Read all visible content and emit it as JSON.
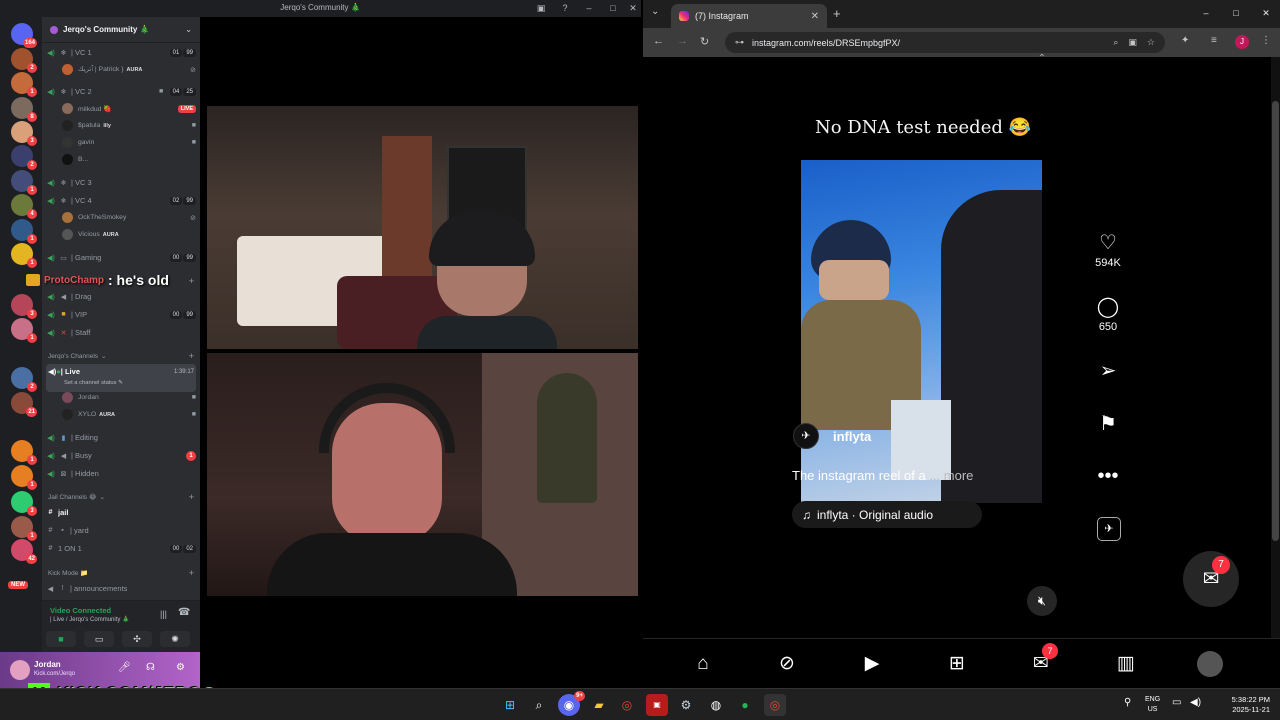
{
  "discord": {
    "window_title": "Jerqo's Community 🎄",
    "server_name": "Jerqo's Community 🎄",
    "rail_badges": [
      "164",
      "2",
      "1",
      "8",
      "3",
      "2",
      "1",
      "4",
      "1",
      "1",
      "3",
      "1",
      "2",
      "21",
      "1",
      "1",
      "3",
      "1",
      "1",
      "42"
    ],
    "rail_new": "NEW",
    "voice_channels": [
      {
        "name": "| VC 1",
        "users": "01",
        "limit": "99"
      },
      {
        "name": "| VC 2",
        "users": "04",
        "limit": "25"
      },
      {
        "name": "| VC 3"
      },
      {
        "name": "| VC 4",
        "users": "02",
        "limit": "99"
      },
      {
        "name": "| Gaming",
        "users": "00",
        "limit": "99"
      },
      {
        "name": "| Drag"
      },
      {
        "name": "| VIP",
        "users": "00",
        "limit": "99"
      },
      {
        "name": "| Staff"
      }
    ],
    "vc1_users": [
      {
        "name": "ﭑﺗﺮﻳﻚ | Patrick }",
        "tag": "AURA"
      }
    ],
    "vc2_users": [
      {
        "name": "milkdud 🍓",
        "live": "LIVE"
      },
      {
        "name": "$patula",
        "tag": "lily"
      },
      {
        "name": "gavin"
      },
      {
        "name": "B..."
      }
    ],
    "vc4_users": [
      {
        "name": "OckTheSmokey"
      },
      {
        "name": "Vicious",
        "tag": "AURA"
      }
    ],
    "category_channels": "Jerqo's Channels",
    "live_channel": {
      "name": "| Live",
      "timer": "1:39:17",
      "status": "Set a channel status"
    },
    "live_users": [
      {
        "name": "Jordan"
      },
      {
        "name": "XYLO",
        "tag": "AURA"
      }
    ],
    "more_channels": [
      {
        "name": "| Editing"
      },
      {
        "name": "| Busy",
        "badge": "1"
      },
      {
        "name": "| Hidden"
      }
    ],
    "category_jail": "Jail Channels 😂",
    "jail_channels": [
      {
        "name": "jail"
      },
      {
        "name": "| yard"
      },
      {
        "name": "1 ON 1",
        "users": "00",
        "limit": "02"
      }
    ],
    "category_kick": "Kick Mode 📁",
    "announcements": "| announcements",
    "chat_overlay": {
      "who": "ProtoChamp",
      "message": ": he's old"
    },
    "voice_panel": {
      "status": "Video Connected",
      "channel": "| Live / Jerqo's Community 🎄"
    },
    "user_panel": {
      "name": "Jordan",
      "sub": "Kick.com/Jerqo"
    }
  },
  "kick_banner": "KICK.COM/JERQO",
  "chrome": {
    "tab_title": "(7) Instagram",
    "url": "instagram.com/reels/DRSEmpbgfPX/"
  },
  "instagram": {
    "reel_title": "No DNA test needed 😂",
    "author": "inflyta",
    "caption": "The instagram reel of a",
    "caption_more": "... more",
    "audio": "inflyta · Original audio",
    "likes": "594K",
    "comments": "650",
    "messenger_badge": "7",
    "nav_badge": "7"
  },
  "taskbar": {
    "lang_line1": "ENG",
    "lang_line2": "US",
    "time": "5:38:22 PM",
    "date": "2025-11-21",
    "discord_badge": "9+"
  },
  "colors": {
    "discord_bg": "#2b2d31",
    "discord_rail": "#1e1f22",
    "live_red": "#ed4245",
    "kick_green": "#53fc18",
    "ig_red": "#ff3040"
  }
}
